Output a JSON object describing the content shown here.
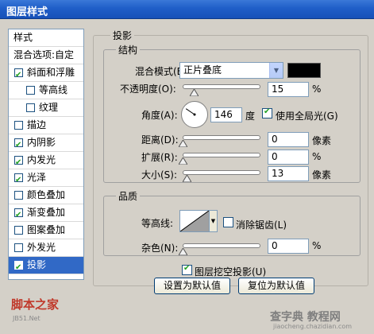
{
  "window": {
    "title": "图层样式"
  },
  "sidebar": {
    "header": "样式",
    "items": [
      {
        "label": "混合选项:自定",
        "checkbox": false,
        "checked": false,
        "indent": false,
        "selected": false
      },
      {
        "label": "斜面和浮雕",
        "checkbox": true,
        "checked": true,
        "indent": false,
        "selected": false
      },
      {
        "label": "等高线",
        "checkbox": true,
        "checked": false,
        "indent": true,
        "selected": false
      },
      {
        "label": "纹理",
        "checkbox": true,
        "checked": false,
        "indent": true,
        "selected": false
      },
      {
        "label": "描边",
        "checkbox": true,
        "checked": false,
        "indent": false,
        "selected": false
      },
      {
        "label": "内阴影",
        "checkbox": true,
        "checked": true,
        "indent": false,
        "selected": false
      },
      {
        "label": "内发光",
        "checkbox": true,
        "checked": true,
        "indent": false,
        "selected": false
      },
      {
        "label": "光泽",
        "checkbox": true,
        "checked": true,
        "indent": false,
        "selected": false
      },
      {
        "label": "颜色叠加",
        "checkbox": true,
        "checked": false,
        "indent": false,
        "selected": false
      },
      {
        "label": "渐变叠加",
        "checkbox": true,
        "checked": true,
        "indent": false,
        "selected": false
      },
      {
        "label": "图案叠加",
        "checkbox": true,
        "checked": false,
        "indent": false,
        "selected": false
      },
      {
        "label": "外发光",
        "checkbox": true,
        "checked": false,
        "indent": false,
        "selected": false
      },
      {
        "label": "投影",
        "checkbox": true,
        "checked": true,
        "indent": false,
        "selected": true
      }
    ]
  },
  "panel": {
    "title": "投影",
    "structure": {
      "title": "结构",
      "blend_mode_label": "混合模式(B):",
      "blend_mode_value": "正片叠底",
      "swatch_color": "#000000",
      "opacity_label": "不透明度(O):",
      "opacity_value": "15",
      "opacity_unit": "%",
      "opacity_level": 15,
      "angle_label": "角度(A):",
      "angle_value": "146",
      "angle_unit": "度",
      "global_light_label": "使用全局光(G)",
      "global_light_checked": true,
      "distance_label": "距离(D):",
      "distance_value": "0",
      "distance_unit": "像素",
      "spread_label": "扩展(R):",
      "spread_value": "0",
      "spread_unit": "%",
      "size_label": "大小(S):",
      "size_value": "13",
      "size_unit": "像素"
    },
    "quality": {
      "title": "品质",
      "contour_label": "等高线:",
      "antialias_label": "消除锯齿(L)",
      "antialias_checked": false,
      "noise_label": "杂色(N):",
      "noise_value": "0",
      "noise_unit": "%"
    },
    "knockout_label": "图层挖空投影(U)",
    "knockout_checked": true,
    "set_default_button": "设置为默认值",
    "reset_default_button": "复位为默认值"
  },
  "watermarks": {
    "left": "脚本之家",
    "left_sub": "JB51.Net",
    "right": "查字典 教程网",
    "right_sub": "jiaocheng.chazidian.com"
  }
}
